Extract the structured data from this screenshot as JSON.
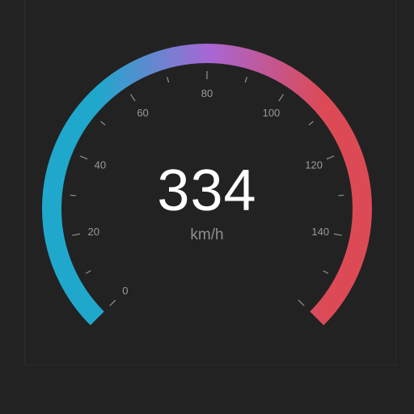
{
  "speedometer": {
    "value": "334",
    "unit": "km/h",
    "scale_labels": [
      "0",
      "20",
      "40",
      "60",
      "80",
      "100",
      "120",
      "140"
    ],
    "colors": {
      "background": "#222222",
      "arc_start": "#1fa8cc",
      "arc_mid": "#a866d4",
      "arc_end": "#dc4a55",
      "tick": "#8a8a8a",
      "label": "#9a9a9a",
      "value_text": "#ffffff"
    }
  }
}
